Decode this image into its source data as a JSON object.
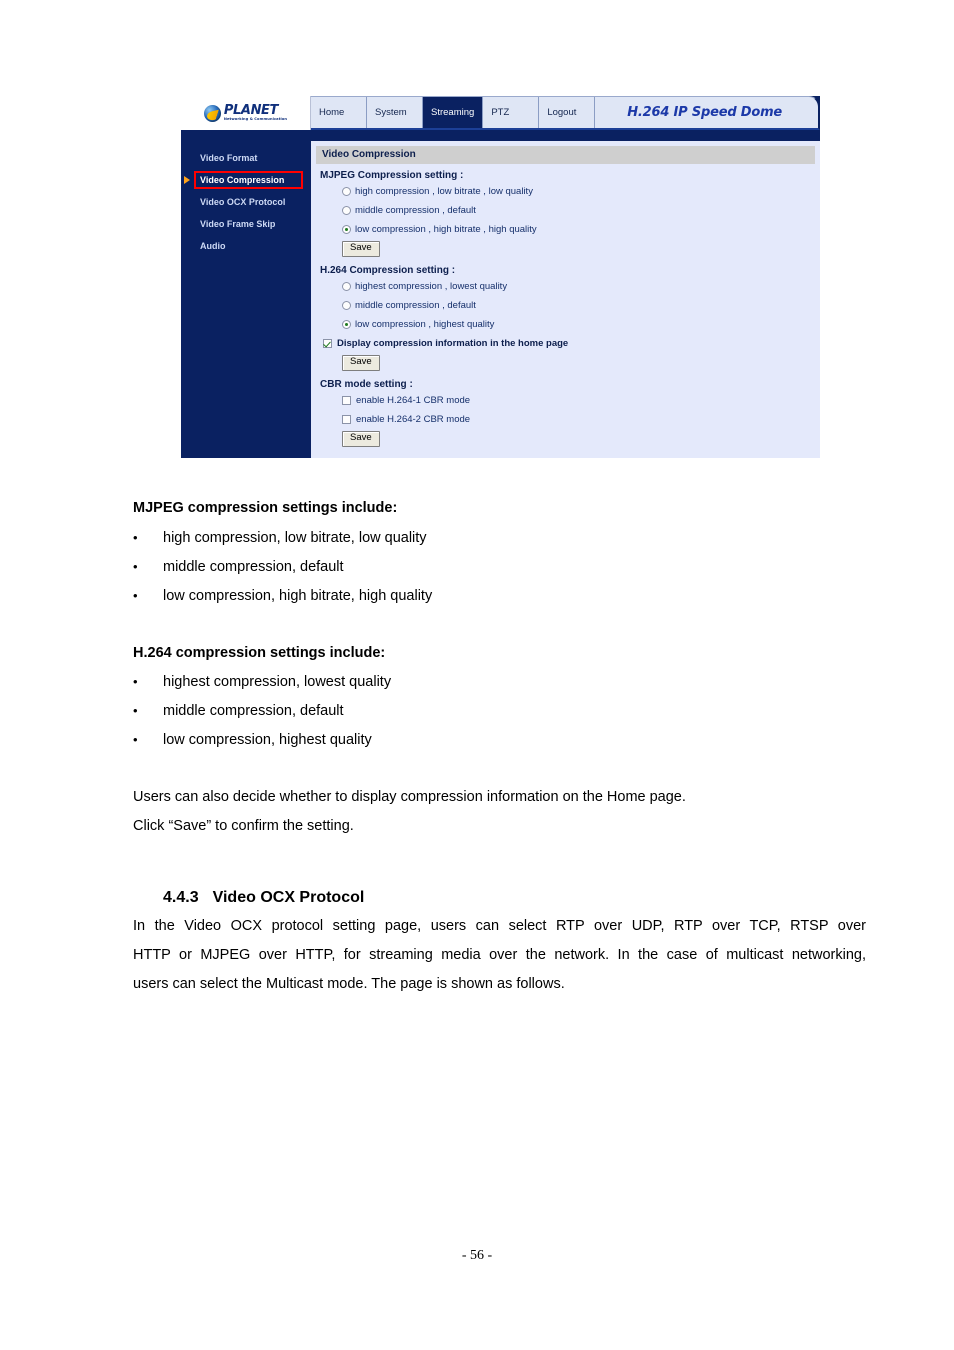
{
  "screenshot": {
    "logo": {
      "name": "PLANET",
      "tagline": "Networking & Communication"
    },
    "nav": {
      "tabs": [
        {
          "label": "Home",
          "active": false
        },
        {
          "label": "System",
          "active": false
        },
        {
          "label": "Streaming",
          "active": true
        },
        {
          "label": "PTZ",
          "active": false
        },
        {
          "label": "Logout",
          "active": false
        }
      ],
      "product_title": "H.264 IP Speed Dome"
    },
    "sidebar": {
      "items": [
        {
          "label": "Video Format",
          "selected": false
        },
        {
          "label": "Video Compression",
          "selected": true
        },
        {
          "label": "Video OCX Protocol",
          "selected": false
        },
        {
          "label": "Video Frame Skip",
          "selected": false
        },
        {
          "label": "Audio",
          "selected": false
        }
      ],
      "highlight_color": "#ff0000",
      "arrow_color": "#ffa31a"
    },
    "panel": {
      "title": "Video Compression",
      "mjpeg": {
        "heading": "MJPEG Compression setting :",
        "options": [
          {
            "label": "high compression , low bitrate , low quality",
            "selected": false
          },
          {
            "label": "middle compression , default",
            "selected": false
          },
          {
            "label": "low compression , high bitrate , high quality",
            "selected": true
          }
        ],
        "save_label": "Save"
      },
      "h264": {
        "heading": "H.264 Compression setting :",
        "options": [
          {
            "label": "highest compression , lowest quality",
            "selected": false
          },
          {
            "label": "middle compression , default",
            "selected": false
          },
          {
            "label": "low compression , highest quality",
            "selected": true
          }
        ],
        "display_info": {
          "label": "Display compression information in the home page",
          "checked": true
        },
        "save_label": "Save"
      },
      "cbr": {
        "heading": "CBR mode setting :",
        "options": [
          {
            "label": "enable H.264-1 CBR mode",
            "checked": false
          },
          {
            "label": "enable H.264-2 CBR mode",
            "checked": false
          }
        ],
        "save_label": "Save"
      }
    }
  },
  "document": {
    "mjpeg_heading": "MJPEG compression settings include:",
    "mjpeg_bullets": [
      "high compression, low bitrate, low quality",
      "middle compression, default",
      "low compression, high bitrate, high quality"
    ],
    "h264_heading": "H.264 compression settings include:",
    "h264_bullets": [
      "highest compression, lowest quality",
      "middle compression, default",
      "low compression, highest quality"
    ],
    "note_line1": "Users can also decide whether to display compression information on the Home page.",
    "note_line2": "Click “Save” to confirm the setting.",
    "section": {
      "number": "4.4.3",
      "title": "Video OCX Protocol"
    },
    "section_body": [
      "In the Video OCX protocol setting page, users can select RTP over UDP, RTP over TCP, RTSP over",
      "HTTP or MJPEG over HTTP, for streaming media over the network. In the case of multicast networking,",
      "users can select the Multicast mode. The page is shown as follows."
    ],
    "page_number": "- 56 -"
  }
}
